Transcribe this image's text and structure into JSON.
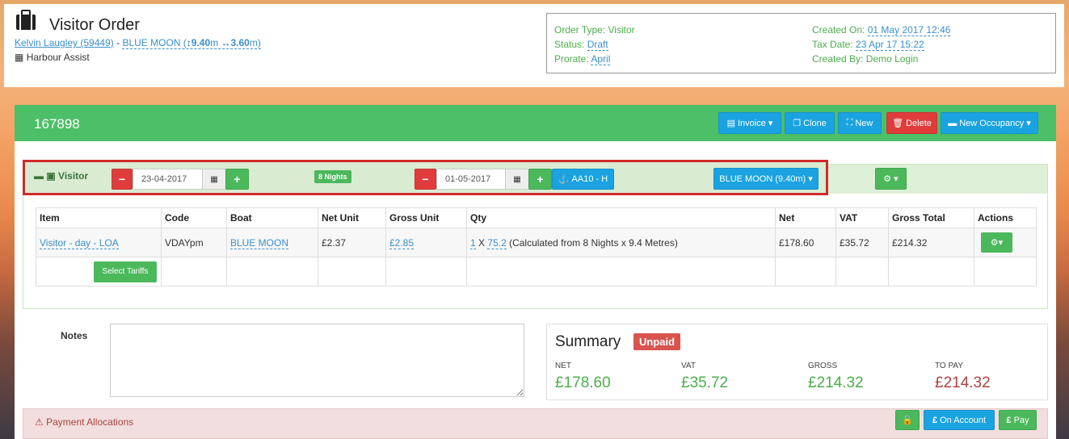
{
  "header": {
    "title": "Visitor Order",
    "customer": "Kelvin Laugley (59449)",
    "separator": "-",
    "boat": "BLUE MOON (",
    "length": "9.40",
    "length_unit": "m",
    "beam": "3.60",
    "beam_unit": "m)",
    "source": "Harbour Assist"
  },
  "info": {
    "order_type_label": "Order Type:",
    "order_type": "Visitor",
    "status_label": "Status:",
    "status": "Draft",
    "prorate_label": "Prorate:",
    "prorate": "April",
    "created_on_label": "Created On:",
    "created_on": "01 May 2017 12:46",
    "tax_date_label": "Tax Date:",
    "tax_date": "23 Apr 17 15:22",
    "created_by_label": "Created By:",
    "created_by": "Demo Login"
  },
  "panel": {
    "order_number": "167898",
    "buttons": {
      "invoice": "Invoice",
      "clone": "Clone",
      "new": "New",
      "delete": "Delete",
      "new_occupancy": "New Occupancy"
    }
  },
  "line": {
    "type": "Visitor",
    "from_date": "23-04-2017",
    "nights": "8 Nights",
    "to_date": "01-05-2017",
    "berth": "AA10 - H",
    "boat_button": "BLUE MOON (9.40m)"
  },
  "table": {
    "headers": [
      "Item",
      "Code",
      "Boat",
      "Net Unit",
      "Gross Unit",
      "Qty",
      "Net",
      "VAT",
      "Gross Total",
      "Actions"
    ],
    "row": {
      "item": "Visitor - day - LOA",
      "code": "VDAYpm",
      "boat": "BLUE MOON",
      "net_unit": "£2.37",
      "gross_unit": "£2.85",
      "qty_a": "1",
      "qty_x": "X",
      "qty_b": "75.2",
      "qty_note": "(Calculated from 8 Nights x 9.4 Metres)",
      "net": "£178.60",
      "vat": "£35.72",
      "gross_total": "£214.32"
    },
    "select_tariffs": "Select Tariffs"
  },
  "notes": {
    "label": "Notes",
    "value": ""
  },
  "summary": {
    "title": "Summary",
    "status": "Unpaid",
    "net_label": "NET",
    "net": "£178.60",
    "vat_label": "VAT",
    "vat": "£35.72",
    "gross_label": "GROSS",
    "gross": "£214.32",
    "topay_label": "TO PAY",
    "topay": "£214.32"
  },
  "payments": {
    "label": "Payment Allocations",
    "on_account": "On Account",
    "pay": "Pay"
  },
  "colors": {
    "green": "#4cbf68",
    "blue": "#1aa3e0",
    "red": "#e03c3c",
    "highlight": "#cf2a2a"
  }
}
